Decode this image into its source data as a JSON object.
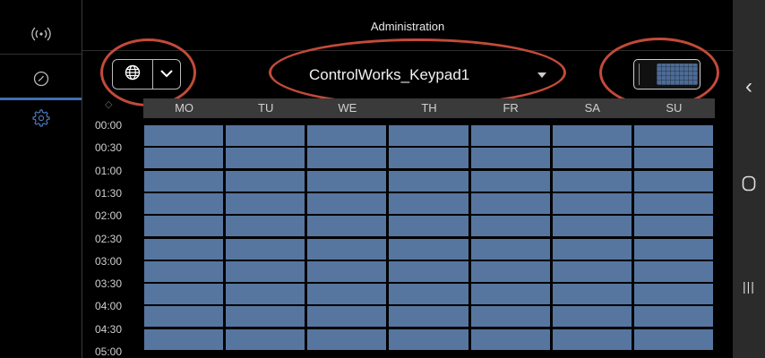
{
  "header": {
    "title": "Administration"
  },
  "device": {
    "name": "ControlWorks_Keypad1"
  },
  "rail": {
    "items": [
      {
        "name": "broadcast",
        "icon": "broadcast-icon"
      },
      {
        "name": "schedule",
        "icon": "clock-icon"
      },
      {
        "name": "settings",
        "icon": "gear-icon",
        "active": true
      }
    ]
  },
  "schedule": {
    "days": [
      "MO",
      "TU",
      "WE",
      "TH",
      "FR",
      "SA",
      "SU"
    ],
    "times": [
      "00:00",
      "00:30",
      "01:00",
      "01:30",
      "02:00",
      "02:30",
      "03:00",
      "03:30",
      "04:00",
      "04:30",
      "05:00"
    ],
    "slot_color": "#57769f"
  },
  "colors": {
    "annotation": "#c44a3a",
    "accent": "#3f6fb0"
  },
  "nav": {
    "back": "‹",
    "home": "○",
    "recents": "|||"
  }
}
